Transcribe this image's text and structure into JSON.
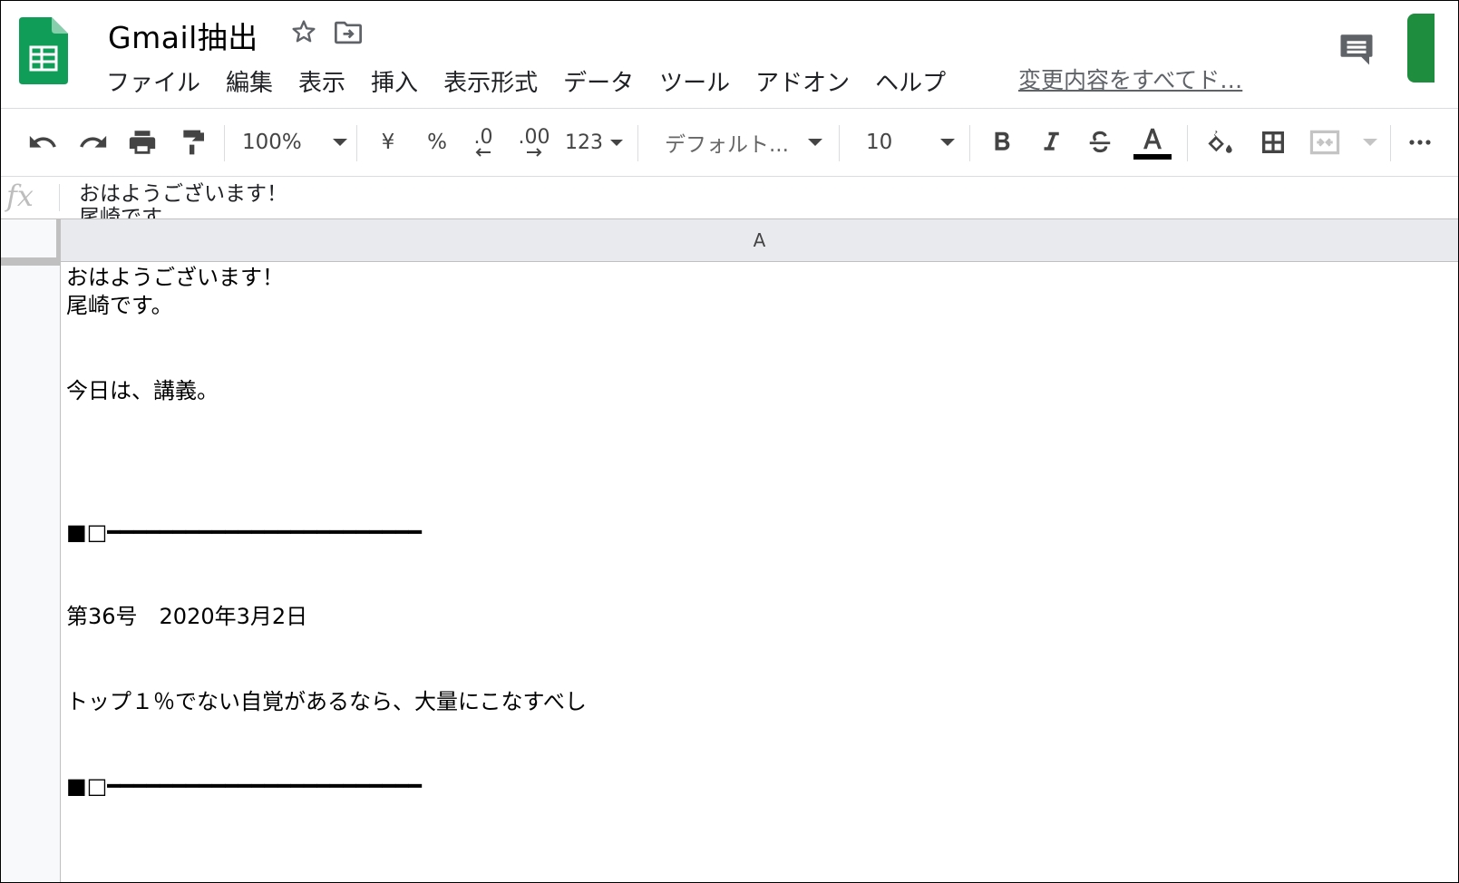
{
  "header": {
    "title": "Gmail抽出",
    "last_edit": "変更内容をすべてド…"
  },
  "menubar": {
    "items": [
      "ファイル",
      "編集",
      "表示",
      "挿入",
      "表示形式",
      "データ",
      "ツール",
      "アドオン",
      "ヘルプ"
    ]
  },
  "toolbar": {
    "zoom": "100%",
    "currency": "¥",
    "percent": "%",
    "decimal_decrease": ".0",
    "decimal_increase": ".00",
    "more_formats": "123",
    "font": "デフォルト...",
    "font_size": "10",
    "text_color": "#000000"
  },
  "formula_bar": {
    "fx_label": "fx",
    "content": "おはようございます！\n尾崎です。"
  },
  "grid": {
    "column_header": "A",
    "cell_lines": [
      "おはようございます！",
      "尾崎です。",
      "",
      "",
      "今日は、講義。",
      "",
      "",
      "",
      "",
      "■□━━━━━━━━━━━━━━━━━━━━━━━━",
      "",
      "",
      "第36号　2020年3月2日",
      "",
      "",
      "トップ１％でない自覚があるなら、大量にこなすべし",
      "",
      "",
      "■□━━━━━━━━━━━━━━━━━━━━━━━━",
      "",
      ""
    ]
  },
  "colors": {
    "sheets_green": "#0f9d58",
    "share_green": "#1e8e3e",
    "header_gray": "#e8eaed"
  }
}
